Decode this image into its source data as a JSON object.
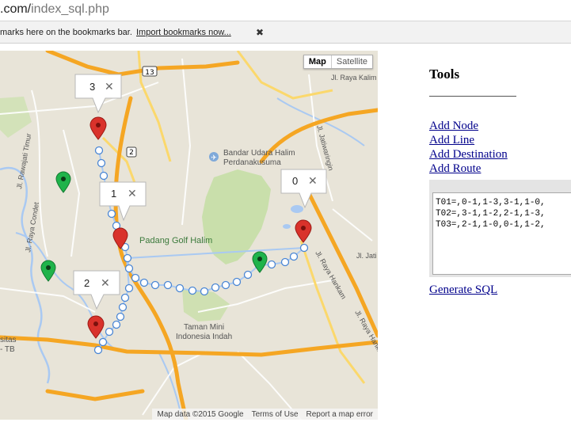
{
  "browser": {
    "url_host": ".com/",
    "url_path": "index_sql.php",
    "bookmarks_message": "marks here on the bookmarks bar.",
    "import_link": "Import bookmarks now...",
    "close_glyph": "✖"
  },
  "map": {
    "type_controls": {
      "map_label": "Map",
      "satellite_label": "Satellite",
      "active": "Map"
    },
    "labels": {
      "airport": "Bandar Udara Halim",
      "airport2": "Perdanakusuma",
      "golf": "Padang Golf Halim",
      "taman1": "Taman Mini",
      "taman2": "Indonesia Indah",
      "road_kalim": "Jl. Raya Kalim",
      "road_jatiwaringin": "Jl. Jatiwaringin",
      "road_rawajati": "Jl. Rawajati Timur",
      "road_condet": "Jl. Raya Condet",
      "road_hankam1": "Jl. Raya Hankam",
      "road_hankam2": "Jl. Raya Hankam",
      "road_jatim": "Jl. Jati M",
      "sitas": "sitas",
      "tb": "- TB",
      "shield_13": "13",
      "shield_2": "2"
    },
    "infowindows": [
      {
        "label": "3",
        "close": "✕"
      },
      {
        "label": "1",
        "close": "✕"
      },
      {
        "label": "0",
        "close": "✕"
      },
      {
        "label": "2",
        "close": "✕"
      }
    ],
    "attribution": {
      "data": "Map data ©2015 Google",
      "terms": "Terms of Use",
      "report": "Report a map error"
    },
    "colors": {
      "land": "#e8e4d8",
      "water": "#a9c9f2",
      "park": "#c9dfab",
      "highway": "#f5a623",
      "marker_red": "#d9322b",
      "marker_green": "#1fb34b",
      "route": "#a9c9f2"
    }
  },
  "tools": {
    "title": "Tools",
    "menu": [
      "Add Node",
      "Add Line",
      "Add Destination",
      "Add Route"
    ],
    "sql_text": "T01=,0-1,1-3,3-1,1-0,\nT02=,3-1,1-2,2-1,1-3,\nT03=,2-1,1-0,0-1,1-2,",
    "generate_label": "Generate SQL"
  }
}
